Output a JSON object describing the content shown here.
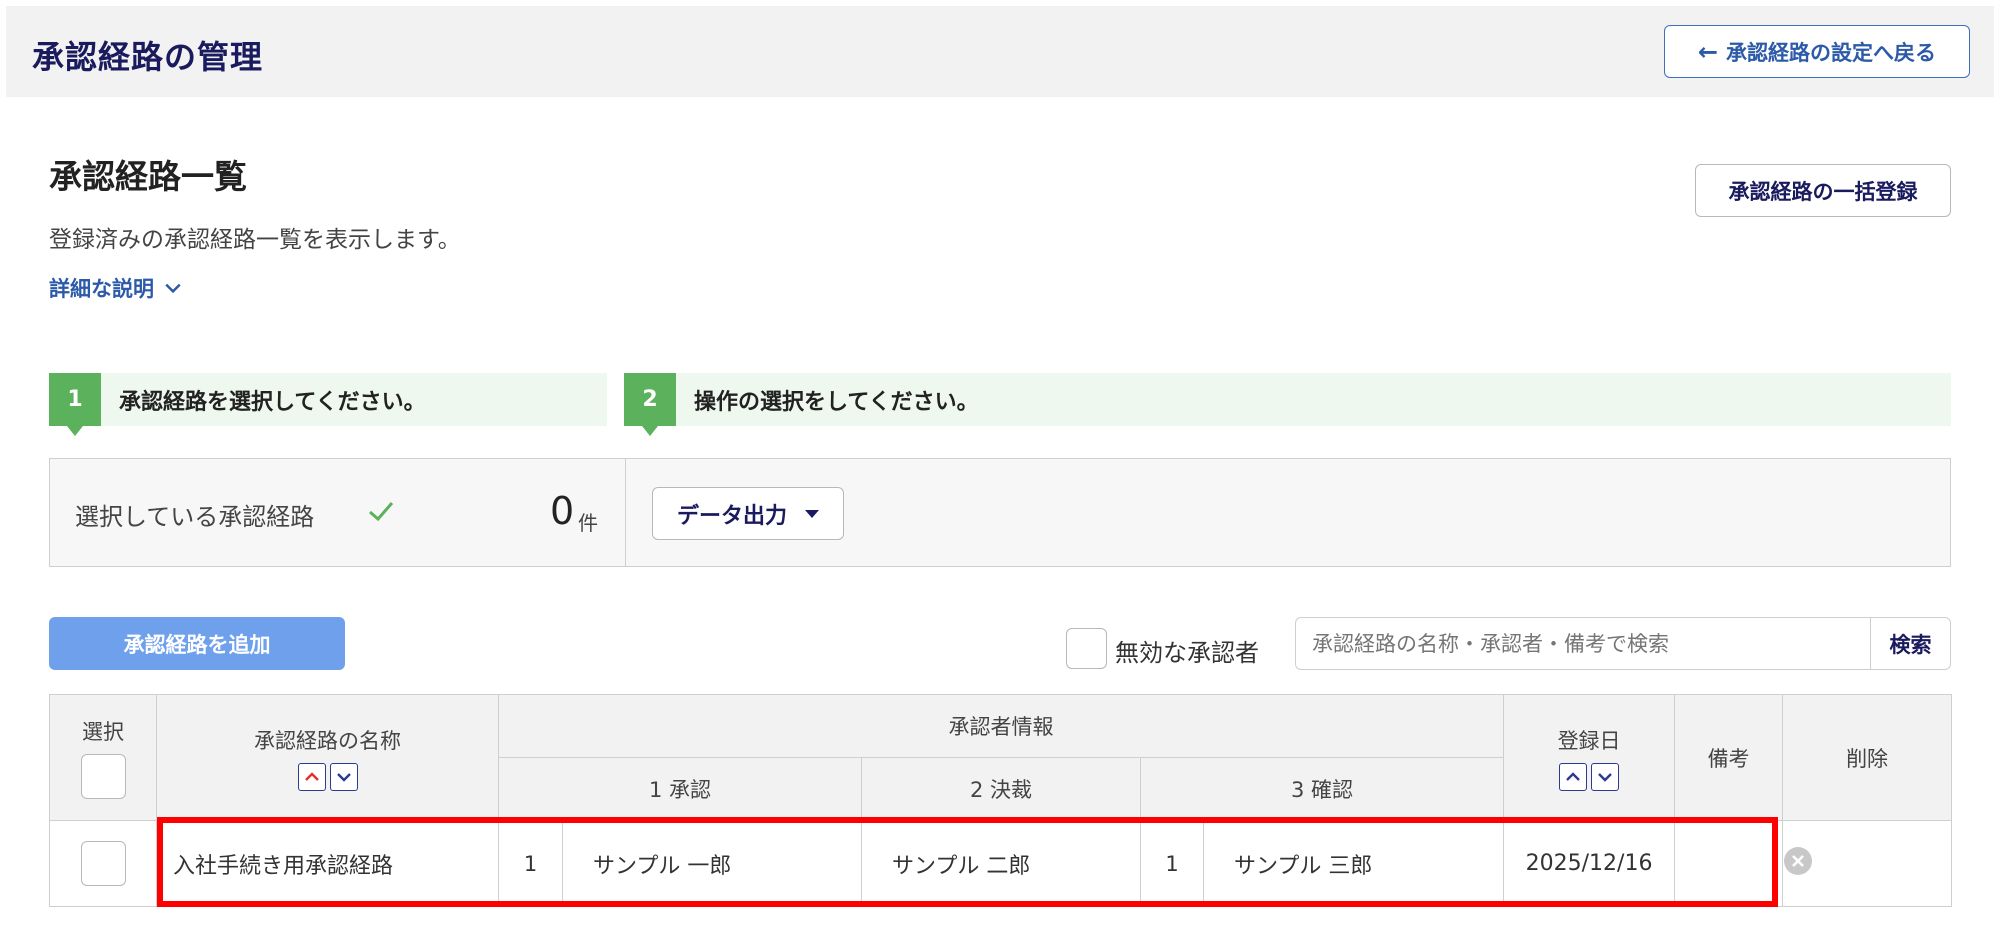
{
  "header": {
    "title": "承認経路の管理",
    "back_label": "承認経路の設定へ戻る"
  },
  "section": {
    "title": "承認経路一覧",
    "description": "登録済みの承認経路一覧を表示します。",
    "detail_link": "詳細な説明",
    "bulk_button": "承認経路の一括登録"
  },
  "steps": [
    {
      "number": "1",
      "label": "承認経路を選択してください。"
    },
    {
      "number": "2",
      "label": "操作の選択をしてください。"
    }
  ],
  "selection": {
    "label": "選択している承認経路",
    "count": "0",
    "unit": "件",
    "export_button": "データ出力"
  },
  "actions": {
    "add_button": "承認経路を追加",
    "inactive_label": "無効な承認者",
    "search_placeholder": "承認経路の名称・承認者・備考で検索",
    "search_button": "検索"
  },
  "table": {
    "headers": {
      "select": "選択",
      "name": "承認経路の名称",
      "approver_info": "承認者情報",
      "step1": "1 承認",
      "step2": "2 決裁",
      "step3": "3 確認",
      "date": "登録日",
      "note": "備考",
      "delete": "削除"
    },
    "rows": [
      {
        "name": "入社手続き用承認経路",
        "step1_count": "1",
        "step1_name": "サンプル 一郎",
        "step2_name": "サンプル 二郎",
        "step3_count": "1",
        "step3_name": "サンプル 三郎",
        "date": "2025/12/16",
        "note": ""
      }
    ]
  },
  "colors": {
    "accent": "#2c5aa8",
    "green": "#5cb15c",
    "add_button": "#6fa0ec",
    "highlight": "#ff0000"
  }
}
